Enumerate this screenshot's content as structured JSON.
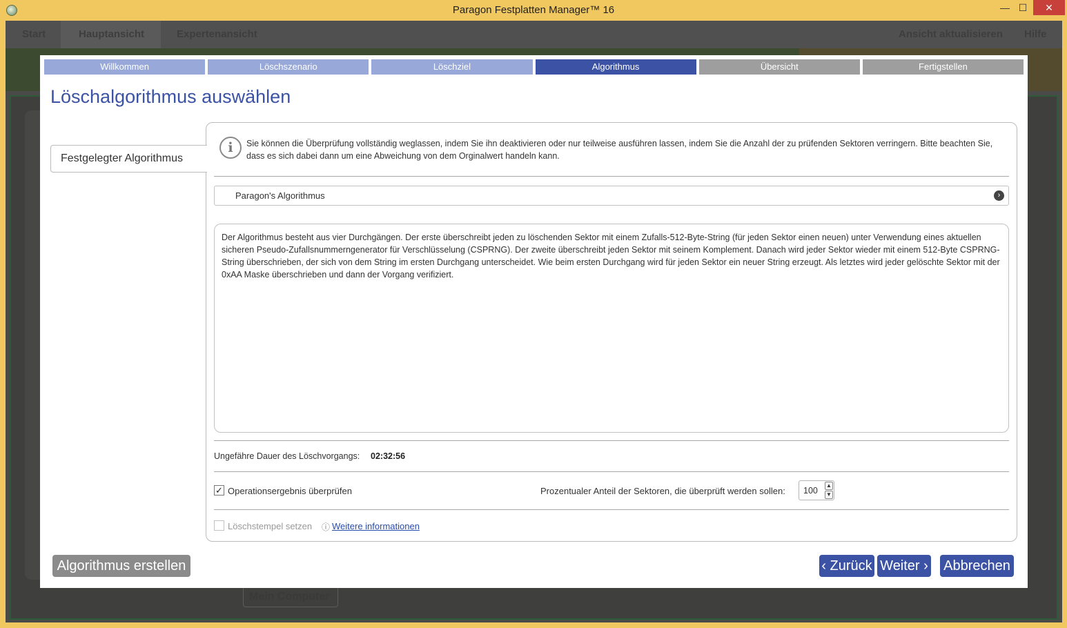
{
  "window": {
    "title": "Paragon Festplatten Manager™ 16",
    "minimize": "—",
    "maximize": "☐",
    "close": "✕"
  },
  "background_app": {
    "nav": [
      "Start",
      "Hauptansicht",
      "Expertenansicht"
    ],
    "refresh": "Ansicht aktualisieren",
    "help": "Hilfe",
    "my_computer": "Mein Computer"
  },
  "wizard": {
    "steps": [
      {
        "label": "Willkommen",
        "state": "done"
      },
      {
        "label": "Löschszenario",
        "state": "done"
      },
      {
        "label": "Löschziel",
        "state": "done"
      },
      {
        "label": "Algorithmus",
        "state": "active"
      },
      {
        "label": "Übersicht",
        "state": "todo"
      },
      {
        "label": "Fertigstellen",
        "state": "todo"
      }
    ],
    "heading": "Löschalgorithmus auswählen",
    "left_tab": "Festgelegter Algorithmus",
    "info_text": "Sie können die Überprüfung vollständig weglassen, indem Sie ihn deaktivieren oder nur teilweise ausführen lassen, indem Sie die Anzahl der zu prüfenden Sektoren verringern. Bitte beachten Sie, dass es sich dabei dann um eine Abweichung von dem Orginalwert handeln kann.",
    "algorithm_select": "Paragon's Algorithmus",
    "description": "Der Algorithmus besteht aus vier Durchgängen. Der erste überschreibt jeden zu löschenden Sektor mit einem Zufalls-512-Byte-String (für jeden Sektor einen neuen) unter Verwendung eines aktuellen sicheren Pseudo-Zufallsnummerngenerator für Verschlüsselung (CSPRNG). Der zweite überschreibt jeden Sektor mit seinem Komplement. Danach wird jeder Sektor wieder mit einem 512-Byte CSPRNG-String überschrieben, der sich von dem String im ersten Durchgang unterscheidet. Wie beim ersten Durchgang wird für jeden Sektor ein neuer String erzeugt. Als letztes wird jeder gelöschte Sektor mit der 0xAA Maske überschrieben und dann der Vorgang verifiziert.",
    "duration_label": "Ungefähre Dauer des Löschvorgangs:",
    "duration_value": "02:32:56",
    "verify_label": "Operationsergebnis überprüfen",
    "verify_checked": true,
    "percent_label": "Prozentualer Anteil der Sektoren, die überprüft werden sollen:",
    "percent_value": "100",
    "stamp_label": "Löschstempel setzen",
    "stamp_checked": false,
    "more_info": "Weitere informationen",
    "buttons": {
      "create_algorithm": "Algorithmus erstellen",
      "back": "‹ Zurück",
      "next": "Weiter ›",
      "cancel": "Abbrechen"
    }
  }
}
